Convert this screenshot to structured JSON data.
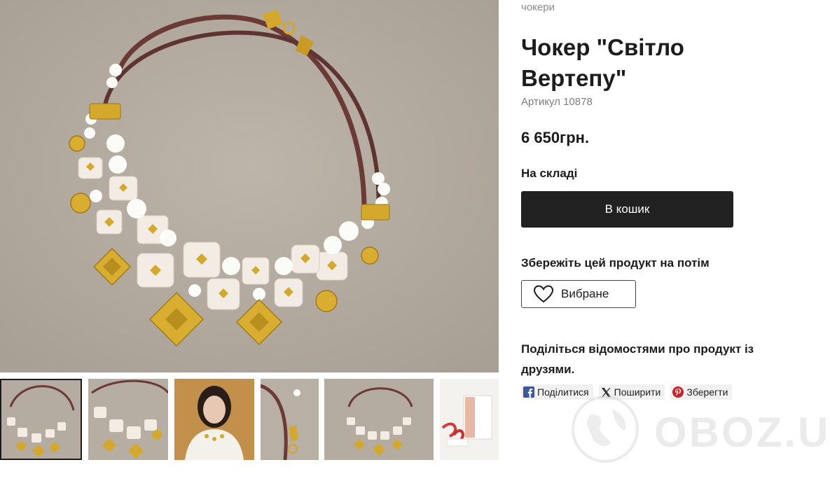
{
  "breadcrumb": "чокери",
  "product": {
    "title": "Чокер \"Світло Вертепу\"",
    "sku": "Артикул 10878",
    "price": "6 650грн.",
    "stock_status": "На складі",
    "cart_button": "В кошик",
    "save_heading": "Збережіть цей продукт на потім",
    "favorite_button": "Вибране",
    "share_heading": "Поділіться відомостями про продукт із друзями."
  },
  "share": {
    "facebook": "Поділитися",
    "x": "Поширити",
    "pinterest": "Зберегти"
  },
  "gallery": {
    "thumbnail_count": 6,
    "active_index": 0
  },
  "watermark": "OBOZ.UA",
  "colors": {
    "button_dark": "#212121",
    "photo_background": "#b5aca2",
    "gold": "#d4a82b",
    "cord": "#6b3a35",
    "facebook_blue": "#3b5998",
    "pinterest_red": "#cb2027"
  }
}
